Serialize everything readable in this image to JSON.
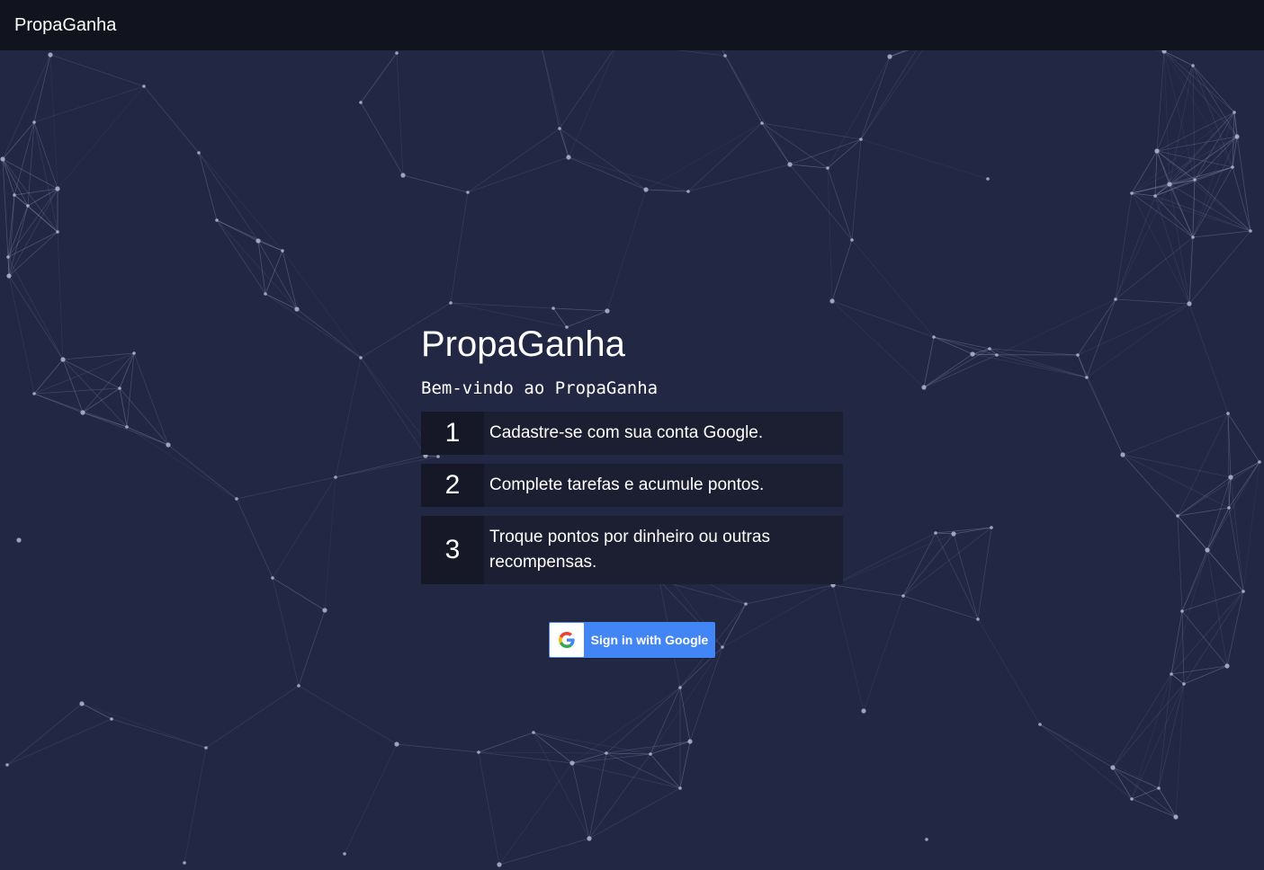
{
  "navbar": {
    "brand": "PropaGanha"
  },
  "main": {
    "title": "PropaGanha",
    "subtitle": "Bem-vindo ao PropaGanha",
    "steps": [
      {
        "number": "1",
        "text": "Cadastre-se com sua conta Google."
      },
      {
        "number": "2",
        "text": "Complete tarefas e acumule pontos."
      },
      {
        "number": "3",
        "text": "Troque pontos por dinheiro ou outras recompensas."
      }
    ]
  },
  "signin": {
    "label": "Sign in with Google",
    "icon": "google-g-icon"
  },
  "colors": {
    "background": "#222744",
    "navbar": "#11131f",
    "step_background": "#1c1e31",
    "step_number_background": "#161827",
    "google_blue": "#4285f4",
    "network_lines": "#9ea3c4"
  }
}
